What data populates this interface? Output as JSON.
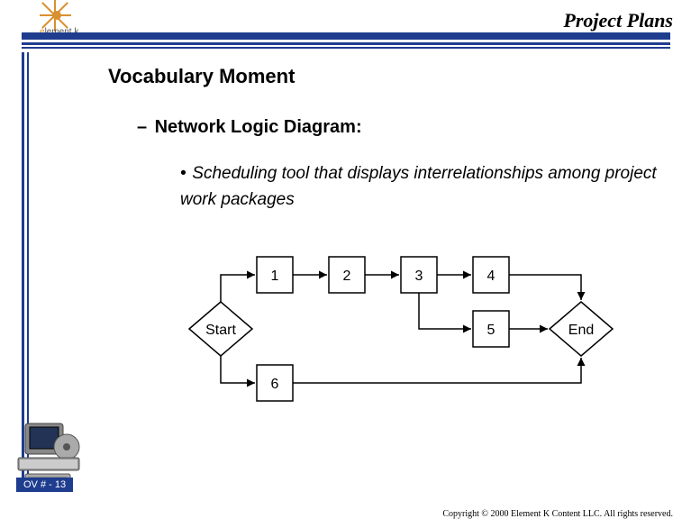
{
  "header": {
    "title": "Project Plans",
    "logo": {
      "brand_prefix": "e",
      "brand_rest": "lement k"
    }
  },
  "content": {
    "section_title": "Vocabulary Moment",
    "dash": "–",
    "subtitle": "Network Logic Diagram:",
    "bullet": "•",
    "bullet_text": "Scheduling tool that displays interrelationships among project work packages"
  },
  "diagram": {
    "start": "Start",
    "end": "End",
    "n1": "1",
    "n2": "2",
    "n3": "3",
    "n4": "4",
    "n5": "5",
    "n6": "6"
  },
  "footer": {
    "ov": "OV # - 13",
    "copyright": "Copyright © 2000 Element K Content LLC. All rights reserved."
  }
}
